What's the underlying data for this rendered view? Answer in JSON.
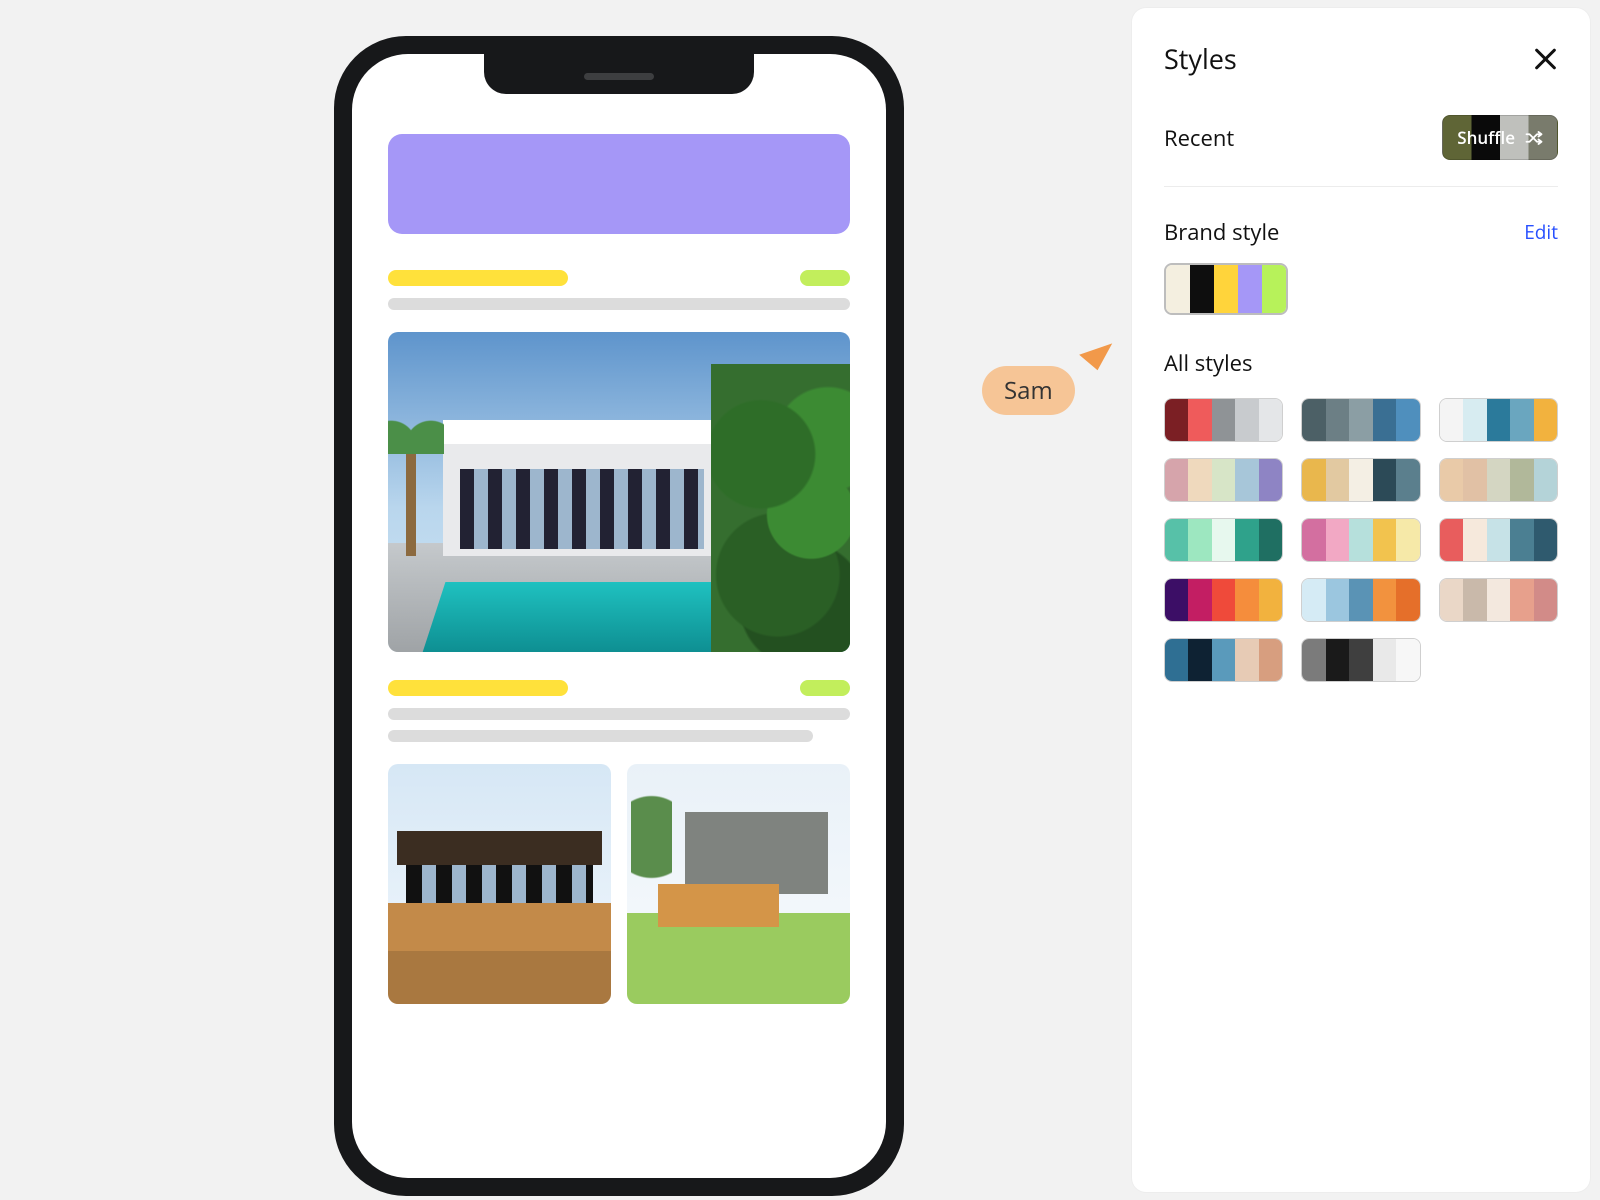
{
  "cursor": {
    "name": "Sam"
  },
  "panel": {
    "title": "Styles",
    "recent_label": "Recent",
    "shuffle_label": "Shuffle",
    "brand_label": "Brand style",
    "edit_label": "Edit",
    "all_label": "All styles",
    "brand_palette": [
      "#f4efe0",
      "#0e0e0e",
      "#ffd43b",
      "#a597f7",
      "#b7f25a"
    ],
    "all_palettes": [
      [
        "#7b1f24",
        "#ef5b5b",
        "#8f9396",
        "#c8cbce",
        "#e4e6e8"
      ],
      [
        "#4c6066",
        "#6c7f85",
        "#8b9ea4",
        "#3a6f93",
        "#4f8fbd"
      ],
      [
        "#f4f4f4",
        "#d7ecf1",
        "#2b7a9b",
        "#6aa6bf",
        "#f2b23e"
      ],
      [
        "#d6a4ab",
        "#efd9bd",
        "#d7e5c7",
        "#a7c6d9",
        "#8e84c4"
      ],
      [
        "#e9b74d",
        "#e2c9a1",
        "#f4efe4",
        "#2c4a57",
        "#5b7f8d"
      ],
      [
        "#e9caa8",
        "#e1c1a5",
        "#d4d6c2",
        "#b1b89a",
        "#b4d3d8"
      ],
      [
        "#57c1a8",
        "#9de7c0",
        "#e7f8ee",
        "#2fa28b",
        "#1f6f62"
      ],
      [
        "#d36fa0",
        "#f2a8c4",
        "#b6e0dc",
        "#f2c34e",
        "#f6e9a8"
      ],
      [
        "#e85d5d",
        "#f6e9dc",
        "#c6e2e7",
        "#4b7f92",
        "#2f5a6e"
      ],
      [
        "#3c0e66",
        "#c31e63",
        "#ef4a3a",
        "#f58d3c",
        "#f2b23e"
      ],
      [
        "#d5ebf5",
        "#9bc6df",
        "#5a93b5",
        "#f2923e",
        "#e56f2a"
      ],
      [
        "#ead7c7",
        "#c9b9aa",
        "#f3e8de",
        "#e7a08c",
        "#d28b88"
      ],
      [
        "#2f6f93",
        "#0e2233",
        "#5a9abb",
        "#e7cbb5",
        "#d79e7f"
      ],
      [
        "#7b7b7b",
        "#1a1a1a",
        "#3f3f3f",
        "#e9e9e9",
        "#f7f7f7"
      ]
    ]
  }
}
